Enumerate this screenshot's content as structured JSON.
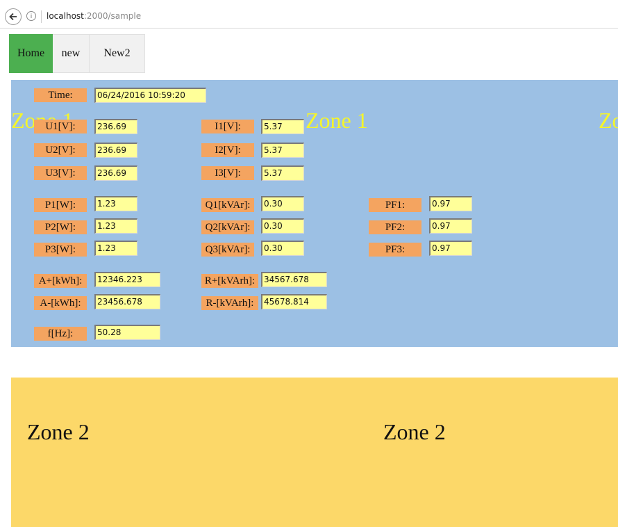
{
  "browser": {
    "url_host": "localhost",
    "url_path": ":2000/sample",
    "info_glyph": "i"
  },
  "nav": {
    "items": [
      {
        "label": "Home",
        "active": true
      },
      {
        "label": "new",
        "active": false
      },
      {
        "label": "New2",
        "active": false
      }
    ]
  },
  "zone1": {
    "title": "Zone 1",
    "time": {
      "label": "Time:",
      "value": "06/24/2016 10:59:20"
    },
    "voltage": [
      {
        "label": "U1[V]:",
        "value": "236.69"
      },
      {
        "label": "U2[V]:",
        "value": "236.69"
      },
      {
        "label": "U3[V]:",
        "value": "236.69"
      }
    ],
    "current": [
      {
        "label": "I1[V]:",
        "value": "5.37"
      },
      {
        "label": "I2[V]:",
        "value": "5.37"
      },
      {
        "label": "I3[V]:",
        "value": "5.37"
      }
    ],
    "power": [
      {
        "label": "P1[W]:",
        "value": "1.23"
      },
      {
        "label": "P2[W]:",
        "value": "1.23"
      },
      {
        "label": "P3[W]:",
        "value": "1.23"
      }
    ],
    "reactive": [
      {
        "label": "Q1[kVAr]:",
        "value": "0.30"
      },
      {
        "label": "Q2[kVAr]:",
        "value": "0.30"
      },
      {
        "label": "Q3[kVAr]:",
        "value": "0.30"
      }
    ],
    "pf": [
      {
        "label": "PF1:",
        "value": "0.97"
      },
      {
        "label": "PF2:",
        "value": "0.97"
      },
      {
        "label": "PF3:",
        "value": "0.97"
      }
    ],
    "energy_active": [
      {
        "label": "A+[kWh]:",
        "value": "12346.223"
      },
      {
        "label": "A-[kWh]:",
        "value": "23456.678"
      }
    ],
    "energy_reactive": [
      {
        "label": "R+[kVArh]:",
        "value": "34567.678"
      },
      {
        "label": "R-[kVArh]:",
        "value": "45678.814"
      }
    ],
    "frequency": {
      "label": "f[Hz]:",
      "value": "50.28"
    }
  },
  "zone2": {
    "title": "Zone 2"
  },
  "colors": {
    "nav_active": "#4caf50",
    "zone1_bg": "#9cc0e4",
    "zone1_title": "#f5f52a",
    "label_bg": "#f4a460",
    "value_bg": "#ffff99",
    "zone2_bg": "#fcd869"
  }
}
